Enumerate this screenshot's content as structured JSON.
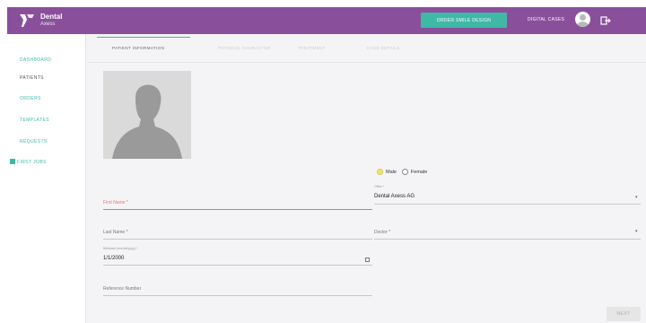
{
  "app": {
    "logo_line1": "Dental",
    "logo_line2": "Axess"
  },
  "header": {
    "order_button": "ORDER SMILE DESIGN",
    "user_name": "DIGITAL CASES"
  },
  "sidebar": {
    "items": [
      "DASHBOARD",
      "PATIENTS",
      "ORDERS",
      "TEMPLATES",
      "REQUESTS",
      "FIRST JOBS"
    ]
  },
  "tabs": [
    "PATIENT INFORMATION",
    "PHYSICAL CHARACTER",
    "TREATMENT",
    "CASE DETAILS"
  ],
  "gender": {
    "male_label": "Male",
    "female_label": "Female",
    "selected": "Male"
  },
  "form": {
    "first_name_label": "First Name *",
    "last_name_label": "Last Name *",
    "dob_label": "Birthdate (mm/dd/yyyy) *",
    "dob_value": "1/1/2000",
    "reference_label": "Reference Number",
    "office_label": "Office *",
    "office_value": "Dental Axess AG",
    "doctor_label": "Doctor *"
  },
  "next_button": "NEXT",
  "colors": {
    "header": "#8a4f9b",
    "accent": "#3fb9a6",
    "error": "#e57373"
  }
}
